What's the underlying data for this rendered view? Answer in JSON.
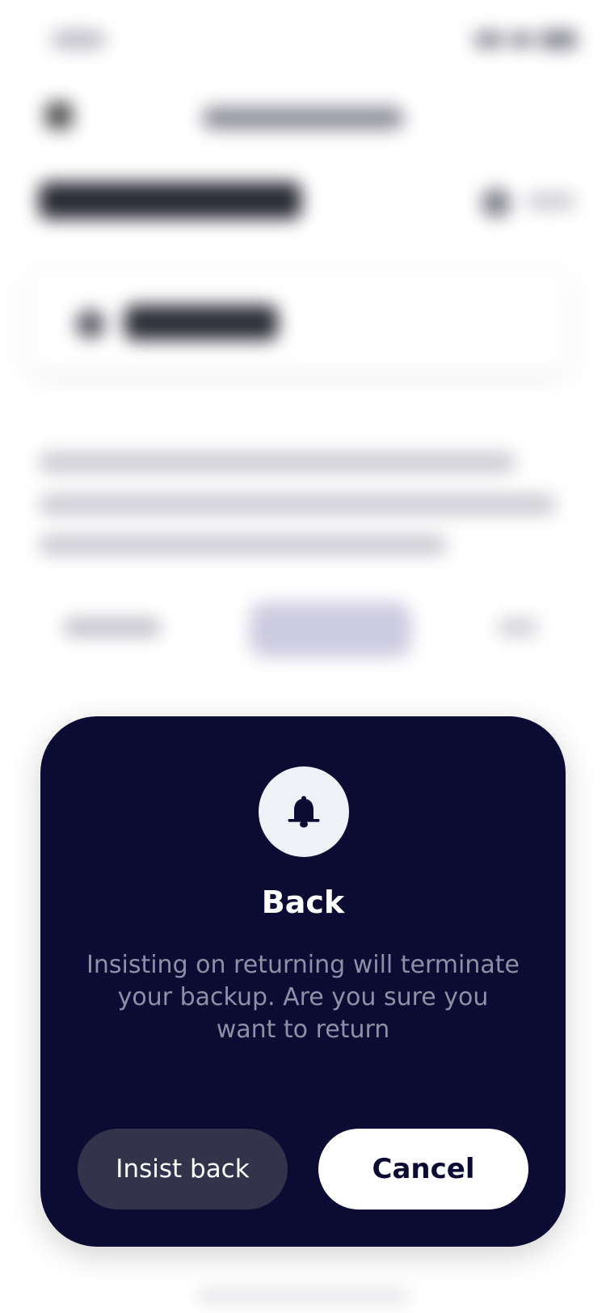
{
  "modal": {
    "icon": "bell-icon",
    "title": "Back",
    "message": "Insisting on returning will terminate your backup. Are you sure you want to return",
    "buttons": {
      "insist_label": "Insist back",
      "cancel_label": "Cancel"
    }
  },
  "colors": {
    "modal_background": "#0b0b33",
    "icon_circle": "#eef1f6",
    "message_text": "#8e90a6",
    "insist_button": "#33334c",
    "cancel_button": "#ffffff"
  }
}
